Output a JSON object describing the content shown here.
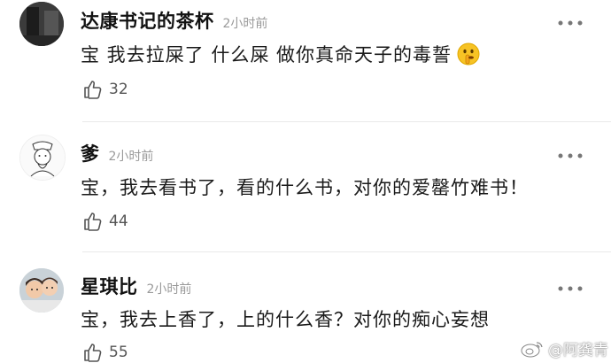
{
  "comments": [
    {
      "username": "达康书记的茶杯",
      "time": "2小时前",
      "text": "宝 我去拉屎了 什么屎  做你真命天子的毒誓",
      "emoji": "shushing-face",
      "likes": "32"
    },
    {
      "username": "爹",
      "time": "2小时前",
      "text": "宝，我去看书了，看的什么书，对你的爱罄竹难书！",
      "likes": "44"
    },
    {
      "username": "星琪比",
      "time": "2小时前",
      "text": "宝，我去上香了，上的什么香？对你的痴心妄想",
      "likes": "55"
    }
  ],
  "watermark": {
    "text": "@阿龚青",
    "icon": "weibo-logo"
  },
  "icons": {
    "like": "thumbs-up-icon",
    "more": "more-dots-icon"
  }
}
